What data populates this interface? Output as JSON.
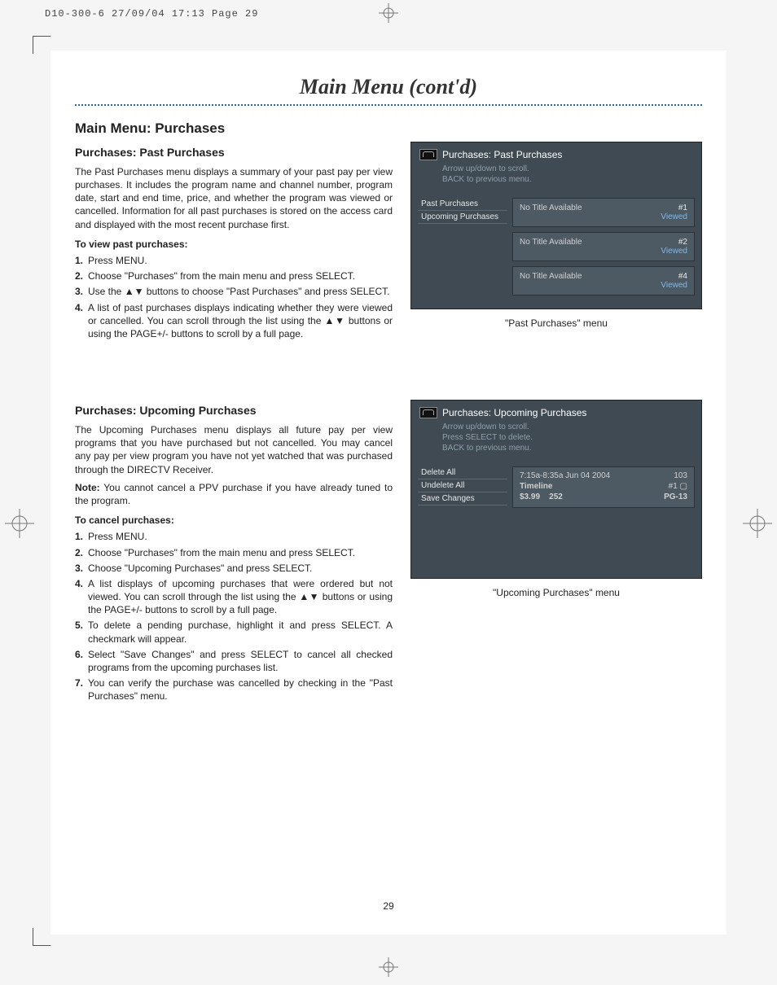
{
  "print_slug": "D10-300-6  27/09/04  17:13  Page 29",
  "page_title": "Main Menu (cont'd)",
  "page_number": "29",
  "section1": {
    "h2": "Main Menu: Purchases",
    "h3": "Purchases: Past Purchases",
    "para": "The Past Purchases menu displays a summary of your past pay per view purchases. It includes the program name and channel number, program date, start and end time, price, and whether the program was viewed or cancelled. Information for all past purchases is stored on the access card and displayed with the most recent purchase first.",
    "bold": "To view past purchases:",
    "steps": [
      "Press MENU.",
      "Choose \"Purchases\" from the main menu and press SELECT.",
      "Use the ▲▼ buttons to choose \"Past Purchases\" and press SELECT.",
      "A list of past purchases displays indicating whether they were viewed or cancelled. You can scroll through the list using the ▲▼ buttons or using the PAGE+/- buttons to scroll by a full page."
    ],
    "caption": "\"Past Purchases\" menu",
    "screenshot": {
      "title": "Purchases: Past Purchases",
      "hint1": "Arrow up/down to scroll.",
      "hint2": "BACK to previous menu.",
      "side": [
        "Past Purchases",
        "Upcoming Purchases"
      ],
      "rows": [
        {
          "l": "No Title Available",
          "n": "#1",
          "s": "Viewed"
        },
        {
          "l": "No Title Available",
          "n": "#2",
          "s": "Viewed"
        },
        {
          "l": "No Title Available",
          "n": "#4",
          "s": "Viewed"
        }
      ]
    }
  },
  "section2": {
    "h3": "Purchases: Upcoming Purchases",
    "para": "The Upcoming Purchases menu displays all future pay per view programs that you have purchased but not cancelled. You may cancel any pay per view program you have not yet watched that was purchased through the DIRECTV Receiver.",
    "note_label": "Note:",
    "note": " You cannot cancel a PPV purchase if you have already tuned to the program.",
    "bold": "To cancel purchases:",
    "steps": [
      "Press MENU.",
      "Choose \"Purchases\" from the main menu and press SELECT.",
      "Choose \"Upcoming Purchases\" and press SELECT.",
      "A list displays of upcoming purchases that were ordered but not viewed. You can scroll through the list using the ▲▼ buttons or using the PAGE+/- buttons to scroll by a full page.",
      "To delete a pending purchase, highlight it and press SELECT. A checkmark will appear.",
      "Select \"Save Changes\" and press SELECT to cancel all checked programs from the upcoming purchases list.",
      "You can verify the purchase was cancelled by checking in the \"Past Purchases\" menu."
    ],
    "caption": "\"Upcoming Purchases\" menu",
    "screenshot": {
      "title": "Purchases: Upcoming Purchases",
      "hint1": "Arrow up/down to scroll.",
      "hint2": "Press SELECT to delete.",
      "hint3": "BACK to previous menu.",
      "side": [
        "Delete All",
        "Undelete All",
        "Save Changes"
      ],
      "row": {
        "time": "7:15a-8:35a Jun   04 2004",
        "ch": "103",
        "title": "Timeline",
        "num": "#1 ▢",
        "price": "$3.99",
        "chnum": "252",
        "rating": "PG-13"
      }
    }
  }
}
